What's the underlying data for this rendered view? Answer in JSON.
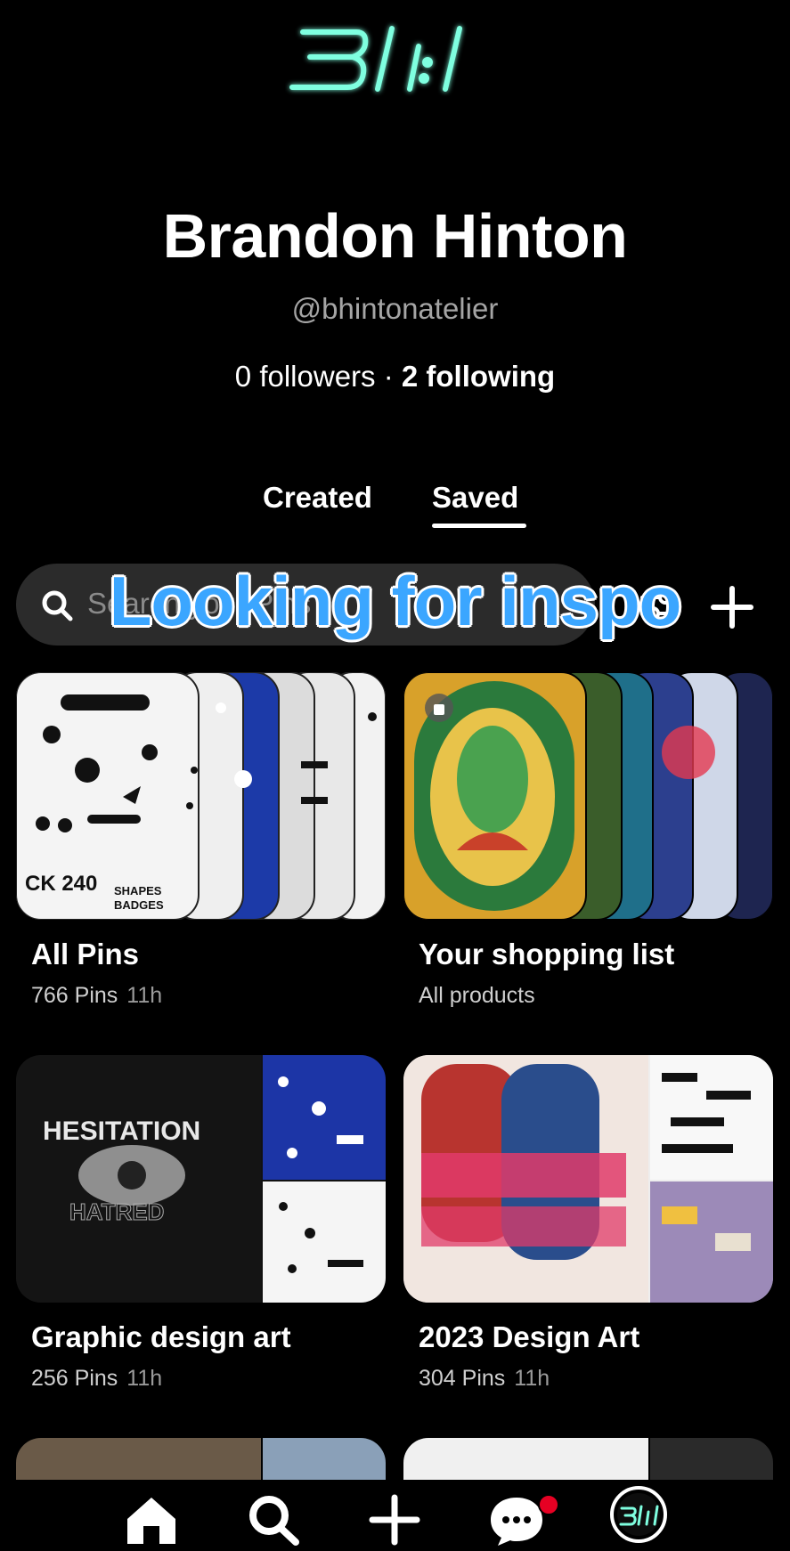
{
  "logo_text": "3I:I",
  "profile": {
    "name": "Brandon Hinton",
    "handle": "@bhintonatelier",
    "followers": "0 followers",
    "separator": " · ",
    "following": "2 following"
  },
  "tabs": [
    {
      "label": "Created",
      "active": false
    },
    {
      "label": "Saved",
      "active": true
    }
  ],
  "search": {
    "placeholder": "Search your Pins"
  },
  "overlay_caption": "Looking for inspo",
  "boards": [
    {
      "title": "All Pins",
      "subtitle": "766 Pins",
      "age": "11h"
    },
    {
      "title": "Your shopping list",
      "subtitle": "All products",
      "age": ""
    },
    {
      "title": "Graphic design art",
      "subtitle": "256 Pins",
      "age": "11h"
    },
    {
      "title": "2023 Design Art",
      "subtitle": "304 Pins",
      "age": "11h"
    }
  ],
  "nav": {
    "items": [
      "home-icon",
      "search-icon",
      "create-icon",
      "messages-icon",
      "profile-avatar"
    ],
    "has_notification": true
  },
  "colors": {
    "background": "#000000",
    "accent_neon": "#7fffe0",
    "caption_blue": "#3ba6ff",
    "notification_red": "#e60023"
  }
}
